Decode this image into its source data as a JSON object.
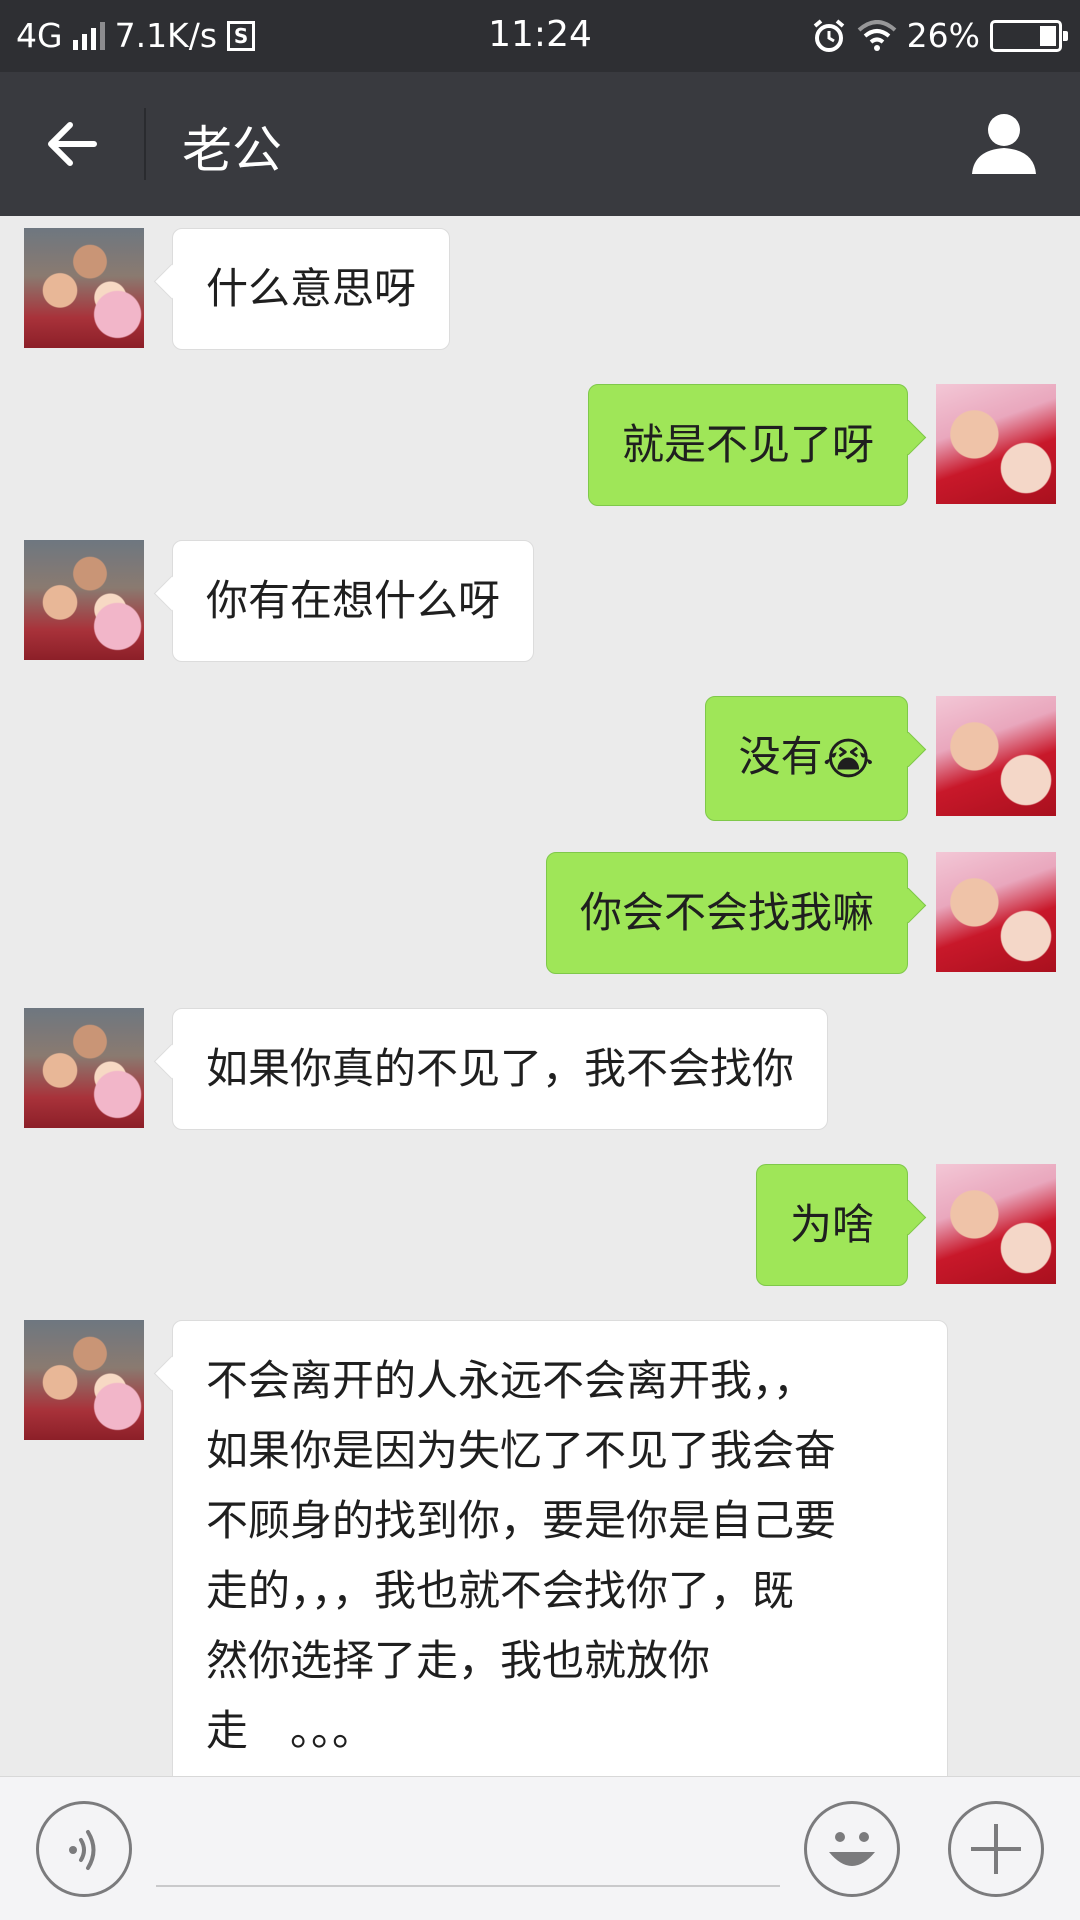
{
  "status_bar": {
    "network": "4G",
    "speed": "7.1K/s",
    "s_badge": "S",
    "time": "11:24",
    "battery": "26%",
    "battery_level": 0.26
  },
  "header": {
    "title": "老公"
  },
  "messages": [
    {
      "side": "in",
      "sender": "husband",
      "text": "什么意思呀"
    },
    {
      "side": "out",
      "sender": "wife",
      "text": "就是不见了呀"
    },
    {
      "side": "in",
      "sender": "husband",
      "text": "你有在想什么呀"
    },
    {
      "side": "out",
      "sender": "wife",
      "text": "没有",
      "emoji": "😭"
    },
    {
      "side": "out",
      "sender": "wife",
      "text": "你会不会找我嘛"
    },
    {
      "side": "in",
      "sender": "husband",
      "text": "如果你真的不见了，我不会找你"
    },
    {
      "side": "out",
      "sender": "wife",
      "text": "为啥"
    },
    {
      "side": "in",
      "sender": "husband",
      "lines": [
        "不会离开的人永远不会离开我，，",
        "如果你是因为失忆了不见了我会奋",
        "不顾身的找到你，要是你是自己要",
        "走的，，，我也就不会找你了，既",
        "然你选择了走，我也就放你",
        "走　。。。"
      ]
    }
  ],
  "input_bar": {
    "placeholder": ""
  },
  "colors": {
    "status_bar_bg": "#2e2f33",
    "header_bg": "#393a3f",
    "chat_bg": "#ebebeb",
    "outgoing_bubble": "#9fe658",
    "incoming_bubble": "#ffffff"
  }
}
